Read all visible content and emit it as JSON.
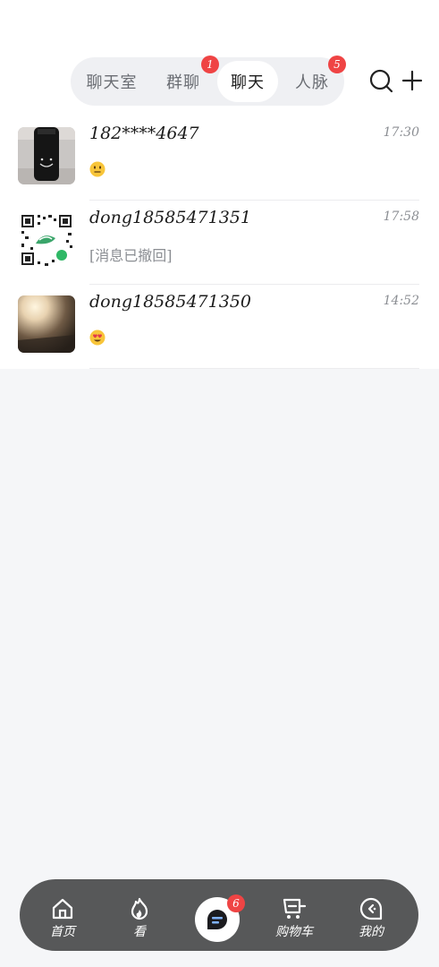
{
  "header": {
    "tabs": [
      {
        "label": "聊天室",
        "badge": null,
        "active": false
      },
      {
        "label": "群聊",
        "badge": "1",
        "active": false
      },
      {
        "label": "聊天",
        "badge": null,
        "active": true
      },
      {
        "label": "人脉",
        "badge": "5",
        "active": false
      }
    ],
    "icons": [
      "search-icon",
      "plus-icon"
    ]
  },
  "chats": [
    {
      "name": "182****4647",
      "time": "17:30",
      "preview": "",
      "preview_emoji": "neutral-face-emoji",
      "avatar": "black-bottle-photo"
    },
    {
      "name": "dong18585471351",
      "time": "17:58",
      "preview": "[消息已撤回]",
      "preview_emoji": null,
      "avatar": "qr-code-avatar"
    },
    {
      "name": "dong18585471350",
      "time": "14:52",
      "preview": "",
      "preview_emoji": "heart-eyes-emoji",
      "avatar": "sunset-photo"
    }
  ],
  "bottom_nav": {
    "items": [
      {
        "label": "首页",
        "icon": "home-icon"
      },
      {
        "label": "看",
        "icon": "flame-icon"
      },
      {
        "label": "购物车",
        "icon": "cart-icon"
      },
      {
        "label": "我的",
        "icon": "profile-icon"
      }
    ],
    "center_badge": "6"
  },
  "colors": {
    "accent_badge": "#ef4444",
    "nav_bg": "#575859",
    "tab_bg": "#eff0f3"
  }
}
